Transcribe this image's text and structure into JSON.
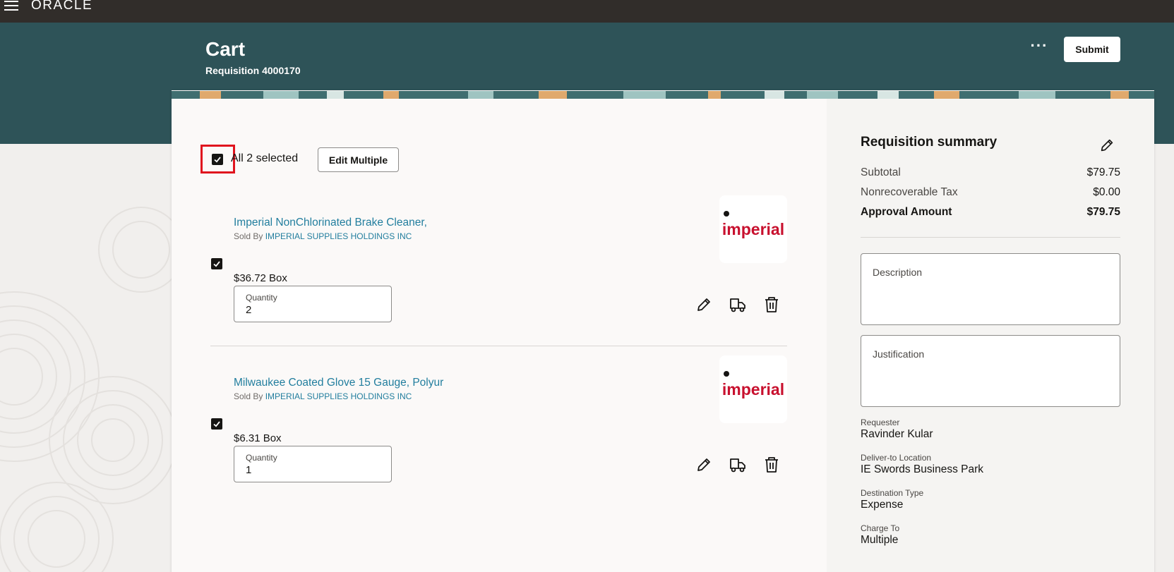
{
  "brand": {
    "logo_text": "ORACLE"
  },
  "header": {
    "title": "Cart",
    "subtitle": "Requisition 4000170",
    "more_label": "···",
    "submit_label": "Submit"
  },
  "selection": {
    "label": "All 2 selected",
    "edit_multiple_label": "Edit Multiple"
  },
  "items": [
    {
      "title": "Imperial NonChlorinated Brake Cleaner,",
      "sold_by_prefix": "Sold By",
      "supplier": "IMPERIAL SUPPLIES HOLDINGS INC",
      "price": "$36.72 Box",
      "quantity_label": "Quantity",
      "quantity": "2",
      "logo_text": "imperial",
      "checked": true
    },
    {
      "title": "Milwaukee Coated Glove 15 Gauge, Polyur",
      "sold_by_prefix": "Sold By",
      "supplier": "IMPERIAL SUPPLIES HOLDINGS INC",
      "price": "$6.31 Box",
      "quantity_label": "Quantity",
      "quantity": "1",
      "logo_text": "imperial",
      "checked": true
    }
  ],
  "summary": {
    "title": "Requisition summary",
    "rows": [
      {
        "label": "Subtotal",
        "value": "$79.75"
      },
      {
        "label": "Nonrecoverable Tax",
        "value": "$0.00"
      },
      {
        "label": "Approval Amount",
        "value": "$79.75"
      }
    ],
    "description_label": "Description",
    "justification_label": "Justification",
    "fields": [
      {
        "label": "Requester",
        "value": "Ravinder Kular"
      },
      {
        "label": "Deliver-to Location",
        "value": "IE Swords Business Park"
      },
      {
        "label": "Destination Type",
        "value": "Expense"
      },
      {
        "label": "Charge To",
        "value": "Multiple"
      }
    ]
  },
  "colors": {
    "header_bg": "#2e5358",
    "topbar_bg": "#312d2a",
    "link": "#227e9e",
    "highlight": "#e0141e",
    "imperial_red": "#c8102e"
  }
}
